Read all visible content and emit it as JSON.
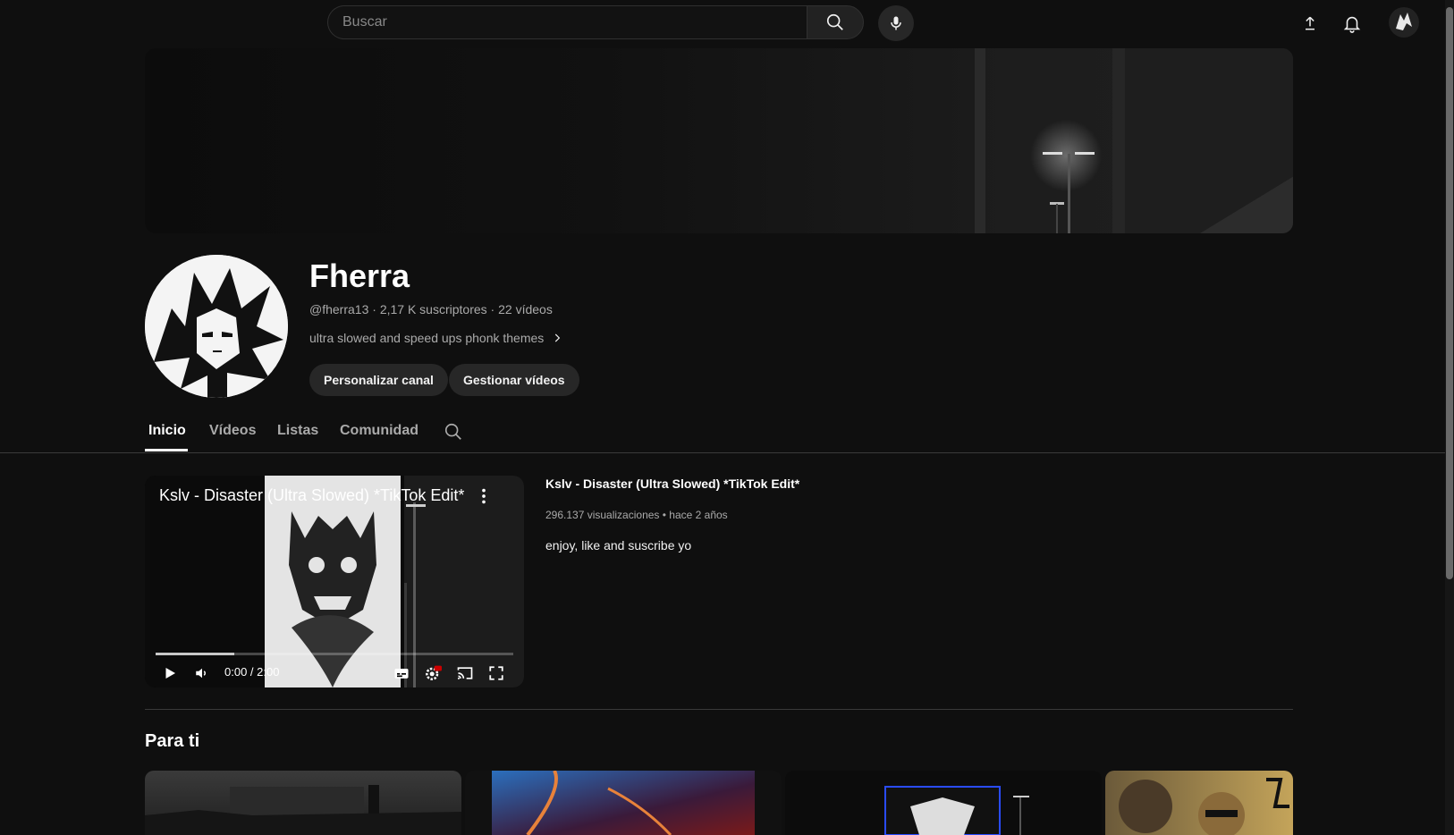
{
  "header": {
    "search_placeholder": "Buscar",
    "icons": [
      "search-icon",
      "mic-icon",
      "upload-icon",
      "bell-icon",
      "account-avatar"
    ]
  },
  "channel": {
    "name": "Fherra",
    "handle": "@fherra13",
    "subscribers": "2,17 K suscriptores",
    "video_count": "22 vídeos",
    "meta_separator": " · ",
    "description": "ultra slowed and speed ups phonk themes",
    "buttons": {
      "customize": "Personalizar canal",
      "manage": "Gestionar vídeos"
    }
  },
  "tabs": [
    {
      "label": "Inicio",
      "active": true
    },
    {
      "label": "Vídeos",
      "active": false
    },
    {
      "label": "Listas",
      "active": false
    },
    {
      "label": "Comunidad",
      "active": false
    }
  ],
  "featured": {
    "player_title": "Kslv - Disaster (Ultra Slowed) *TikTok Edit*",
    "time": "0:00 / 2:00",
    "progress": 0.22,
    "title": "Kslv - Disaster (Ultra Slowed) *TikTok Edit*",
    "views": "296.137 visualizaciones",
    "age": "hace 2 años",
    "meta_separator": " • ",
    "description": "enjoy, like and suscribe yo"
  },
  "section": {
    "title": "Para ti"
  },
  "colors": {
    "background": "#0f0f0f",
    "surface": "#272727",
    "text_primary": "#f1f1f1",
    "text_secondary": "#aaaaaa",
    "hd_badge": "#cc0000"
  }
}
